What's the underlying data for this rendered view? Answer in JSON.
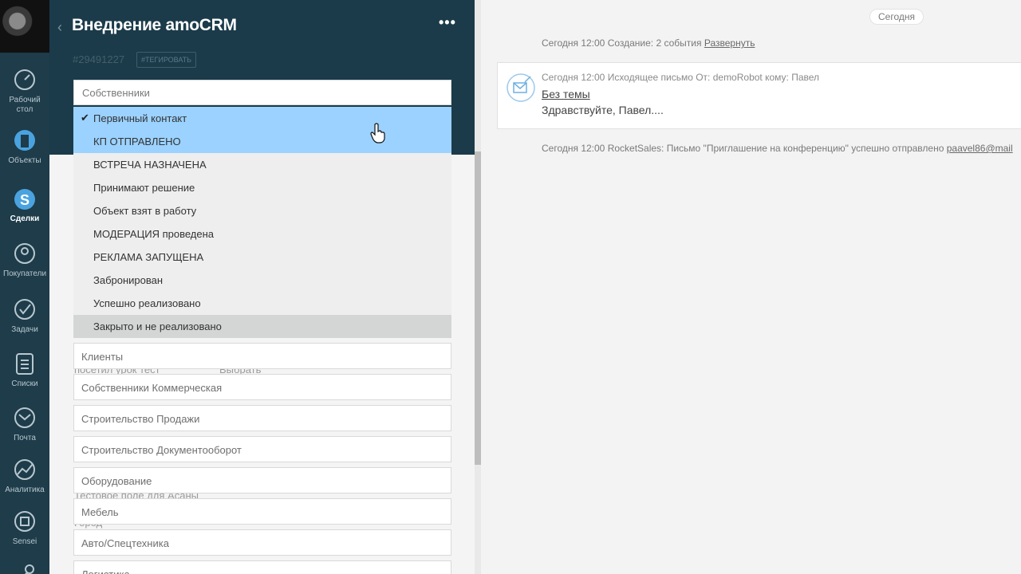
{
  "nav": {
    "items": [
      {
        "label": "Рабочий стол",
        "icon": "dashboard-icon"
      },
      {
        "label": "Объекты",
        "icon": "objects-icon"
      },
      {
        "label": "Сделки",
        "icon": "deals-icon",
        "active": true
      },
      {
        "label": "Покупатели",
        "icon": "customers-icon"
      },
      {
        "label": "Задачи",
        "icon": "tasks-icon"
      },
      {
        "label": "Списки",
        "icon": "lists-icon"
      },
      {
        "label": "Почта",
        "icon": "mail-icon"
      },
      {
        "label": "Аналитика",
        "icon": "analytics-icon"
      },
      {
        "label": "Sensei",
        "icon": "sensei-icon"
      }
    ]
  },
  "deal": {
    "title": "Внедрение amoCRM",
    "more": "•••",
    "id": "#29491227",
    "tag_button": "#ТЕГИРОВАТЬ"
  },
  "dropdown": {
    "current_pipeline": "Собственники",
    "options": [
      {
        "label": "Первичный контакт",
        "selected": true
      },
      {
        "label": "КП ОТПРАВЛЕНО"
      },
      {
        "label": "ВСТРЕЧА НАЗНАЧЕНА"
      },
      {
        "label": "Принимают решение"
      },
      {
        "label": "Объект взят в работу"
      },
      {
        "label": "МОДЕРАЦИЯ проведена"
      },
      {
        "label": "РЕКЛАМА ЗАПУЩЕНА"
      },
      {
        "label": "Забронирован"
      },
      {
        "label": "Успешно реализовано"
      },
      {
        "label": "Закрыто и не реализовано"
      }
    ],
    "pipelines": [
      "Клиенты",
      "Собственники Коммерческая",
      "Строительство Продажи",
      "Строительство Документооборот",
      "Оборудование",
      "Мебель",
      "Авто/Спецтехника",
      "Логистика"
    ]
  },
  "ghost": {
    "visited": "посетил урок тест",
    "choose": "Выбрать",
    "test_field": "Тестовое поле для Асаны",
    "city": "Город",
    "ellipsis": "..."
  },
  "feed": {
    "date_pill": "Сегодня",
    "creation_note": "Сегодня 12:00 Создание: 2 события",
    "expand_link": "Развернуть",
    "mail": {
      "meta": "Сегодня 12:00 Исходящее письмо От: demoRobot кому: Павел",
      "subject": "Без темы",
      "body": "Здравствуйте, Павел...."
    },
    "rocket_note": "Сегодня 12:00 RocketSales: Письмо \"Приглашение на конференцию\" успешно отправлено",
    "rocket_email": "paavel86@mail"
  }
}
